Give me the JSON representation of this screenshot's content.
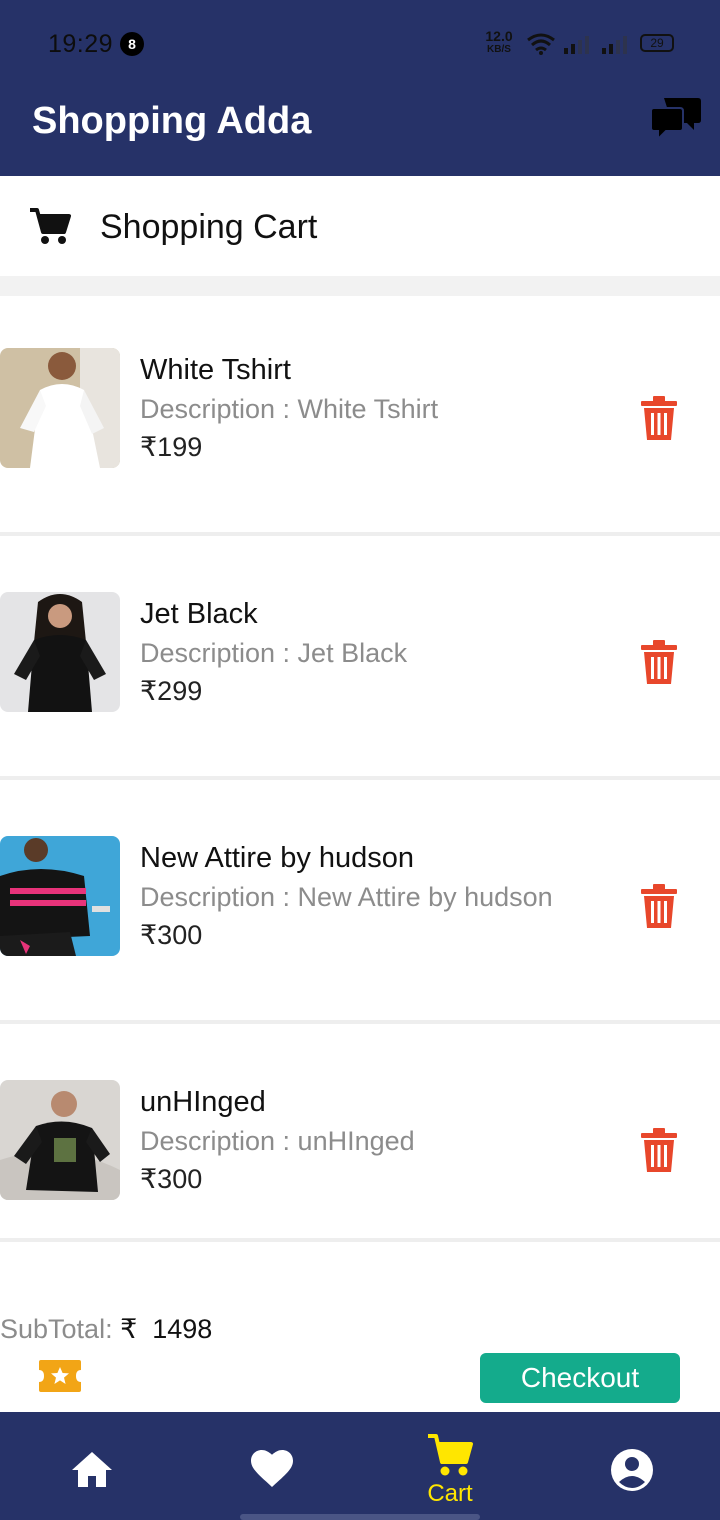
{
  "status_bar": {
    "time": "19:29",
    "notification_count": "8",
    "net_speed": "12.0",
    "net_speed_unit": "KB/S",
    "battery": "29"
  },
  "app": {
    "title": "Shopping Adda",
    "chat_icon": "chat-bubbles-icon",
    "bar_color": "#263268"
  },
  "cart": {
    "title": "Shopping Cart",
    "icon": "cart-icon",
    "items": [
      {
        "name": "White Tshirt",
        "description": "Description : White Tshirt",
        "price": "₹199"
      },
      {
        "name": "Jet Black",
        "description": "Description : Jet Black",
        "price": "₹299"
      },
      {
        "name": "New Attire by hudson",
        "description": "Description : New Attire by hudson",
        "price": "₹300"
      },
      {
        "name": "unHInged",
        "description": "Description : unHInged",
        "price": "₹300"
      }
    ]
  },
  "summary": {
    "subtotal_label": "SubTotal: ",
    "subtotal_value": "₹  1498",
    "checkout_label": "Checkout",
    "coupon_icon": "ticket-star-icon"
  },
  "nav": {
    "items": [
      {
        "icon": "home-icon",
        "label": ""
      },
      {
        "icon": "heart-icon",
        "label": ""
      },
      {
        "icon": "cart-icon",
        "label": "Cart"
      },
      {
        "icon": "account-icon",
        "label": ""
      }
    ],
    "active_color": "#ffe600"
  },
  "colors": {
    "delete": "#e8472b",
    "checkout": "#14ab8c"
  }
}
